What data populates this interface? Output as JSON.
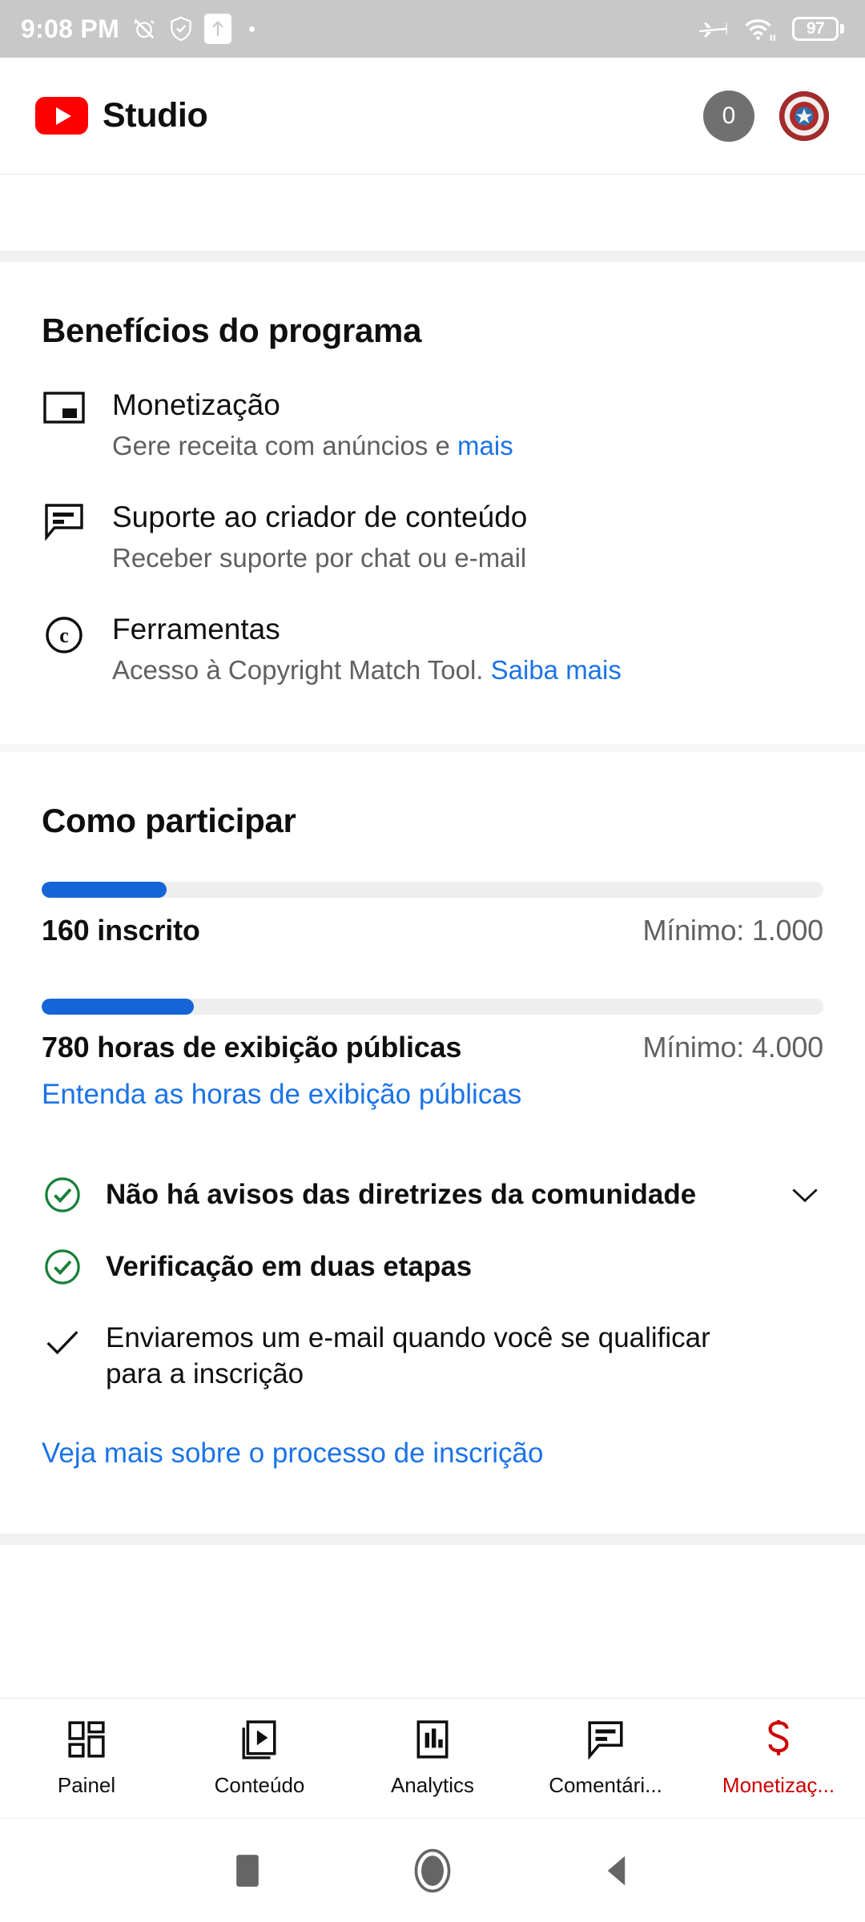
{
  "status_bar": {
    "time": "9:08 PM",
    "icons": [
      "alarm-off-icon",
      "shield-icon",
      "upload-icon",
      "dot-icon"
    ],
    "right_icons": [
      "airplane-mode-icon",
      "wifi-icon"
    ],
    "battery_level": "97"
  },
  "app_bar": {
    "brand": "Studio",
    "logo": "youtube-logo",
    "notification_count": "0",
    "avatar": "captain-america-shield-avatar"
  },
  "benefits_section": {
    "title": "Benefícios do programa",
    "items": [
      {
        "icon": "monetization-icon",
        "title": "Monetização",
        "subtitle_text": "Gere receita com anúncios e ",
        "subtitle_link": "mais"
      },
      {
        "icon": "creator-support-icon",
        "title": "Suporte ao criador de conteúdo",
        "subtitle_text": "Receber suporte por chat ou e-mail",
        "subtitle_link": ""
      },
      {
        "icon": "copyright-icon",
        "title": "Ferramentas",
        "subtitle_text": "Acesso à Copyright Match Tool. ",
        "subtitle_link": "Saiba mais"
      }
    ]
  },
  "join_section": {
    "title": "Como participar",
    "progress": [
      {
        "current_label": "160 inscrito",
        "minimum_label": "Mínimo: 1.000",
        "percent": 16,
        "link": ""
      },
      {
        "current_label": "780 horas de exibição públicas",
        "minimum_label": "Mínimo: 4.000",
        "percent": 19.5,
        "link": "Entenda as horas de exibição públicas"
      }
    ],
    "requirements": [
      {
        "icon": "check-circle-icon",
        "label": "Não há avisos das diretrizes da comunidade",
        "has_chevron": true,
        "bold": true
      },
      {
        "icon": "check-circle-icon",
        "label": "Verificação em duas etapas",
        "has_chevron": false,
        "bold": true
      },
      {
        "icon": "check-icon",
        "label": "Enviaremos um e-mail quando você se qualificar para a inscrição",
        "has_chevron": false,
        "bold": false
      }
    ],
    "footer_link": "Veja mais sobre o processo de inscrição"
  },
  "bottom_nav": {
    "items": [
      {
        "icon": "dashboard-icon",
        "label": "Painel",
        "active": false
      },
      {
        "icon": "content-icon",
        "label": "Conteúdo",
        "active": false
      },
      {
        "icon": "analytics-icon",
        "label": "Analytics",
        "active": false
      },
      {
        "icon": "comments-icon",
        "label": "Comentári...",
        "active": false
      },
      {
        "icon": "monetization-icon",
        "label": "Monetizaç...",
        "active": true
      }
    ]
  },
  "android_nav": {
    "buttons": [
      "recents-icon",
      "home-icon",
      "back-icon"
    ]
  },
  "colors": {
    "accent_blue": "#1a73e8",
    "progress_blue": "#1565d8",
    "active_red": "#cc0000",
    "youtube_red": "#ff0000",
    "check_green": "#188038",
    "muted_text": "#606060"
  }
}
